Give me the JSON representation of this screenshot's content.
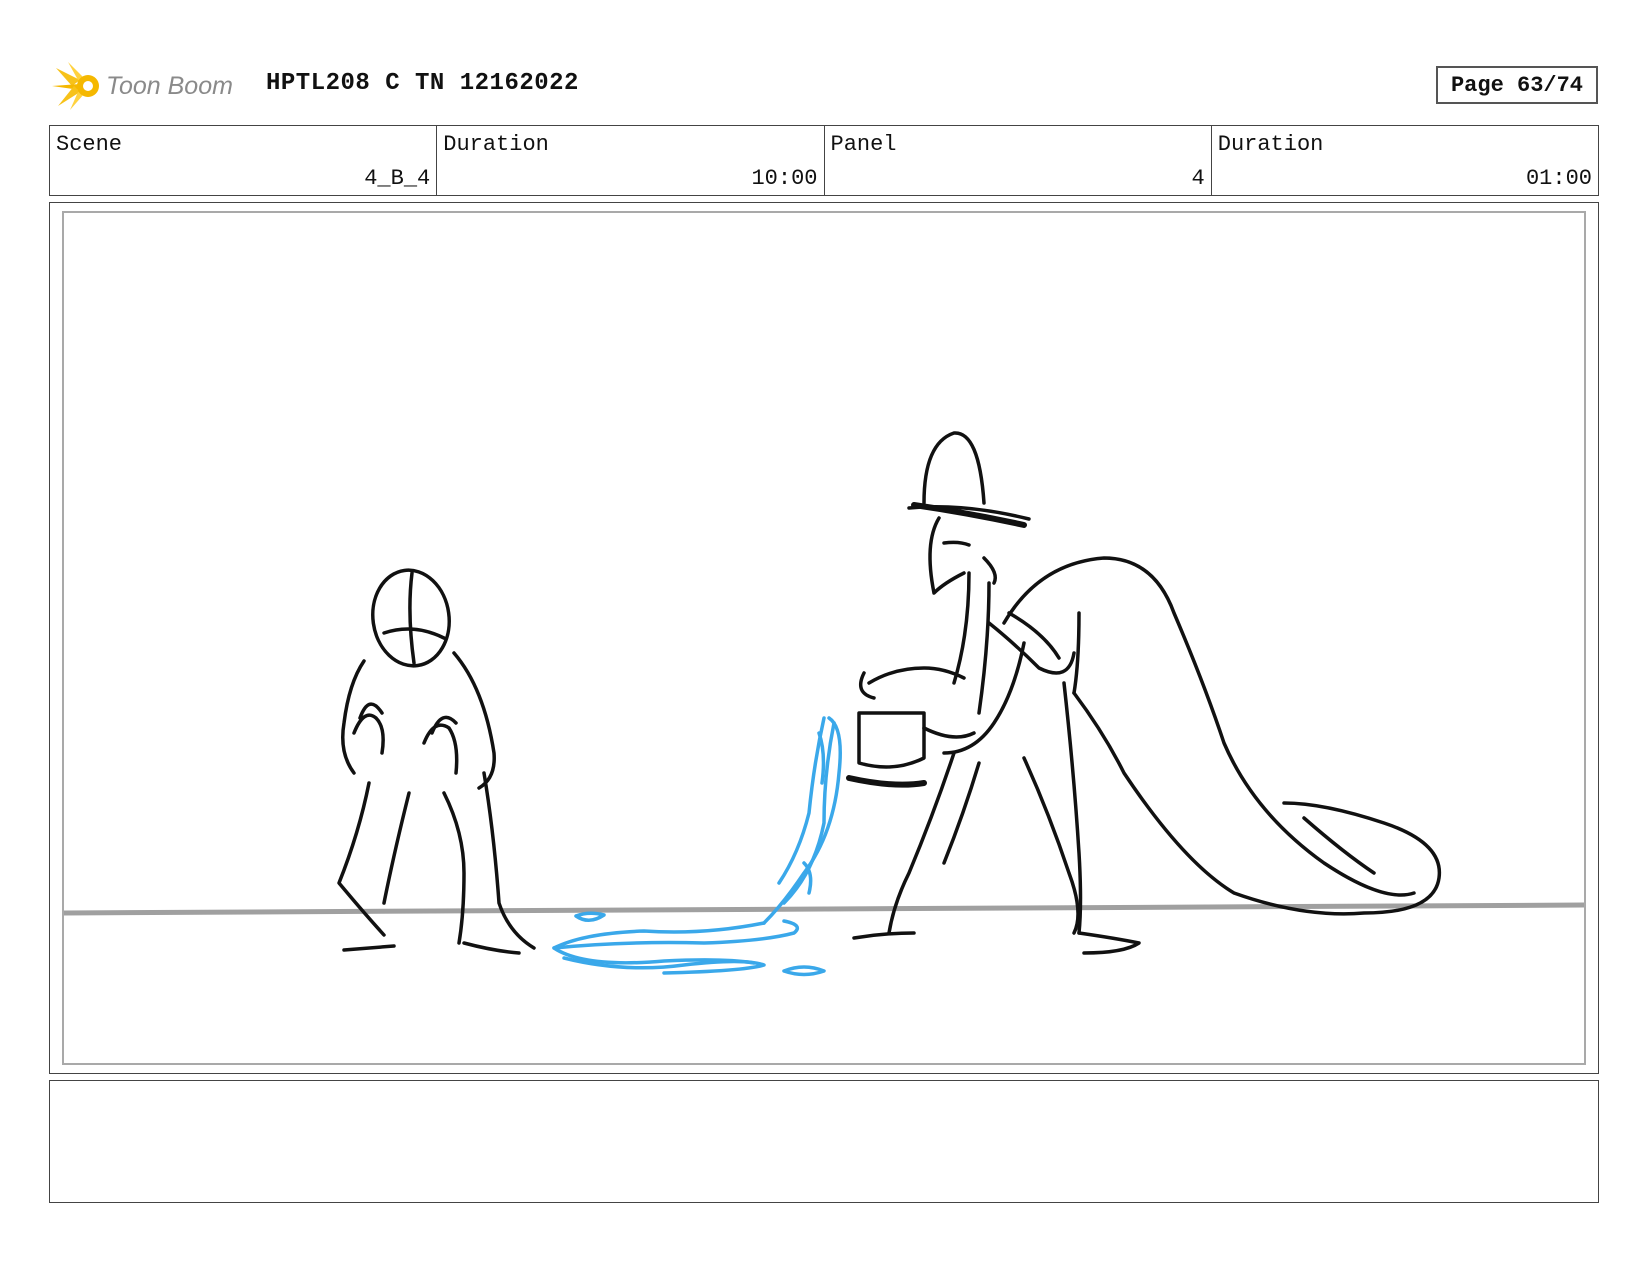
{
  "header": {
    "logo_text": "Toon Boom",
    "project_title": "HPTL208 C TN 12162022",
    "page_label": "Page 63/74"
  },
  "info": {
    "scene_label": "Scene",
    "scene_value": "4_B_4",
    "scene_duration_label": "Duration",
    "scene_duration_value": "10:00",
    "panel_label": "Panel",
    "panel_value": "4",
    "panel_duration_label": "Duration",
    "panel_duration_value": "01:00"
  },
  "colors": {
    "logo_yellow": "#f5b800",
    "logo_text_gray": "#8a8a8a",
    "sketch_black": "#111111",
    "water_blue": "#3aa8ea",
    "horizon_gray": "#a0a0a0"
  },
  "notes": {
    "text": ""
  }
}
